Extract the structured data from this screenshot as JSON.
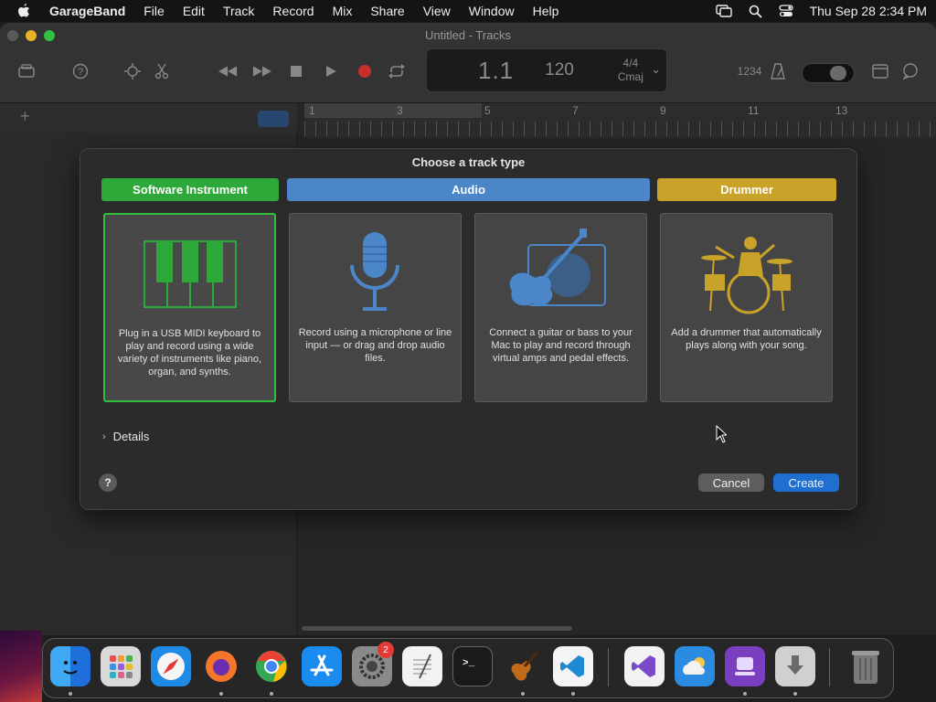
{
  "menubar": {
    "app": "GarageBand",
    "items": [
      "File",
      "Edit",
      "Track",
      "Record",
      "Mix",
      "Share",
      "View",
      "Window",
      "Help"
    ],
    "clock": "Thu Sep 28  2:34 PM"
  },
  "window": {
    "title": "Untitled - Tracks",
    "lcd": {
      "position": "1.1",
      "tempo": "120",
      "time_signature": "4/4",
      "key": "Cmaj"
    },
    "count_in": "1234",
    "ruler_numbers": [
      "1",
      "3",
      "5",
      "7",
      "9",
      "11",
      "13"
    ]
  },
  "dialog": {
    "title": "Choose a track type",
    "types": [
      {
        "label": "Software Instrument",
        "color": "#2fa83a",
        "description": "Plug in a USB MIDI keyboard to play and record using a wide variety of instruments like piano, organ, and synths."
      },
      {
        "label": "Audio",
        "color": "#4a86c8",
        "description": "Record using a microphone or line input — or drag and drop audio files."
      },
      {
        "description": "Connect a guitar or bass to your Mac to play and record through virtual amps and pedal effects."
      },
      {
        "label": "Drummer",
        "color": "#c9a22a",
        "description": "Add a drummer that automatically plays along with your song."
      }
    ],
    "selected": "Software Instrument",
    "details_label": "Details",
    "help_label": "?",
    "cancel_label": "Cancel",
    "create_label": "Create"
  },
  "dock": {
    "items": [
      "finder-icon",
      "launchpad-icon",
      "safari-icon",
      "firefox-icon",
      "chrome-icon",
      "app-store-icon",
      "system-settings-icon",
      "textedit-icon",
      "terminal-icon",
      "garageband-icon",
      "vscode-icon",
      "visual-studio-icon",
      "icloud-weather-icon",
      "podcast-icon",
      "downloads-icon",
      "trash-icon"
    ],
    "badge": "2"
  }
}
